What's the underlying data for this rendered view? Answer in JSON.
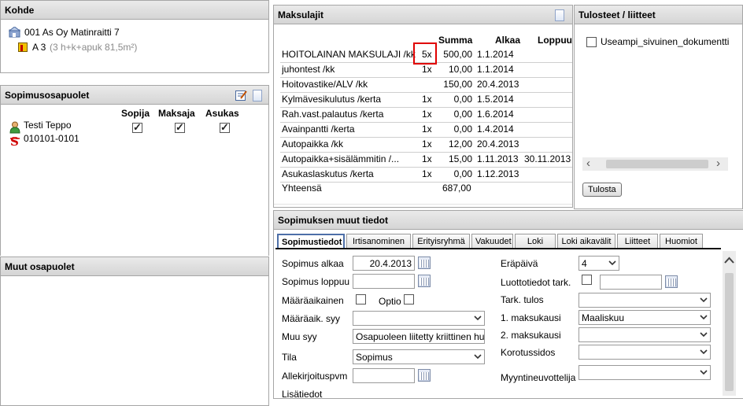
{
  "kohde": {
    "title": "Kohde",
    "property": "001 As Oy Matinraitti 7",
    "apartment": "A 3",
    "apartment_detail": "(3 h+k+apuk  81,5m²)"
  },
  "parties": {
    "title": "Sopimusosapuolet",
    "columns": [
      "Sopija",
      "Maksaja",
      "Asukas"
    ],
    "person_name": "Testi Teppo",
    "person_id": "010101-0101",
    "checks": [
      true,
      true,
      true
    ]
  },
  "other_parties": {
    "title": "Muut osapuolet"
  },
  "payments": {
    "title": "Maksulajit",
    "headers": [
      "Summa",
      "Alkaa",
      "Loppuu"
    ],
    "rows": [
      {
        "name": "HOITOLAINAN MAKSULAJI /kk",
        "qty": "5x",
        "sum": "500,00",
        "start": "1.1.2014",
        "end": ""
      },
      {
        "name": "juhontest /kk",
        "qty": "1x",
        "sum": "10,00",
        "start": "1.1.2014",
        "end": ""
      },
      {
        "name": "Hoitovastike/ALV /kk",
        "qty": "",
        "sum": "150,00",
        "start": "20.4.2013",
        "end": ""
      },
      {
        "name": "Kylmävesikulutus /kerta",
        "qty": "1x",
        "sum": "0,00",
        "start": "1.5.2014",
        "end": ""
      },
      {
        "name": "Rah.vast.palautus /kerta",
        "qty": "1x",
        "sum": "0,00",
        "start": "1.6.2014",
        "end": ""
      },
      {
        "name": "Avainpantti /kerta",
        "qty": "1x",
        "sum": "0,00",
        "start": "1.4.2014",
        "end": ""
      },
      {
        "name": "Autopaikka /kk",
        "qty": "1x",
        "sum": "12,00",
        "start": "20.4.2013",
        "end": ""
      },
      {
        "name": "Autopaikka+sisälämmitin /...",
        "qty": "1x",
        "sum": "15,00",
        "start": "1.11.2013",
        "end": "30.11.2013"
      },
      {
        "name": "Asukaslaskutus /kerta",
        "qty": "1x",
        "sum": "0,00",
        "start": "1.12.2013",
        "end": ""
      }
    ],
    "total_label": "Yhteensä",
    "total_value": "687,00"
  },
  "prints": {
    "title": "Tulosteet / liitteet",
    "items": [
      {
        "label": "Useampi_sivuinen_dokumentti",
        "checked": false
      }
    ],
    "print_button": "Tulosta"
  },
  "other_info": {
    "title": "Sopimuksen muut tiedot",
    "tabs": [
      "Sopimustiedot",
      "Irtisanominen",
      "Erityisryhmä",
      "Vakuudet",
      "Loki",
      "Loki aikavälit",
      "Liitteet",
      "Huomiot"
    ],
    "active_tab": "Sopimustiedot",
    "form": {
      "start_label": "Sopimus alkaa",
      "start_value": "20.4.2013",
      "end_label": "Sopimus loppuu",
      "end_value": "",
      "fixed_label": "Määräaikainen",
      "option_label": "Optio",
      "fixed_reason_label": "Määräaik. syy",
      "fixed_reason_value": "",
      "other_reason_label": "Muu syy",
      "other_reason_value": "Osapuoleen liitetty kriittinen hu",
      "state_label": "Tila",
      "state_value": "Sopimus",
      "signed_label": "Allekirjoituspvm",
      "signed_value": "",
      "extra_label": "Lisätiedot",
      "due_label": "Eräpäivä",
      "due_value": "4",
      "credit_label": "Luottotiedot tark.",
      "credit_value": "",
      "check_result_label": "Tark. tulos",
      "check_result_value": "",
      "month1_label": "1. maksukausi",
      "month1_value": "Maaliskuu",
      "month2_label": "2. maksukausi",
      "month2_value": "",
      "raise_label": "Korotussidos",
      "raise_value": "",
      "seller_label": "Myyntineuvottelija",
      "seller_value": ""
    }
  },
  "colors": {
    "header_bg": "#dcdcdc",
    "highlight": "#e00000",
    "tab_active_border": "#4d6fa8"
  }
}
